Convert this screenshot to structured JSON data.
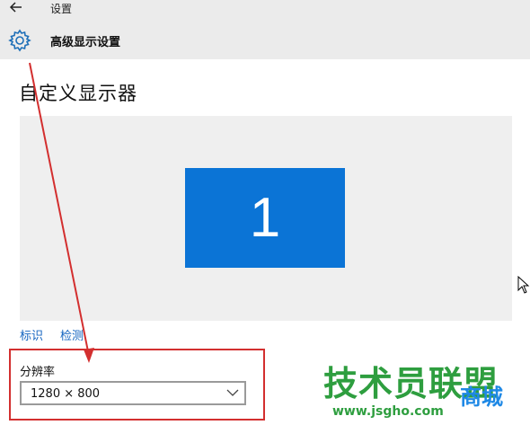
{
  "titlebar": {
    "title": "设置"
  },
  "header": {
    "page_name": "高级显示设置"
  },
  "main": {
    "title": "自定义显示器",
    "monitor_number": "1",
    "identify_link": "标识",
    "detect_link": "检测",
    "resolution_label": "分辨率",
    "resolution_value": "1280 × 800"
  },
  "watermark": {
    "logo_text": "技术员联盟",
    "accent_text": "商城",
    "url": "www.jsgho.com"
  },
  "colors": {
    "accent": "#0b74d6",
    "annotation": "#d32f2f",
    "link": "#1565c0",
    "watermark": "#2e9e3f"
  },
  "icons": [
    "back-arrow-icon",
    "gear-icon",
    "chevron-down-icon",
    "mouse-cursor-icon"
  ]
}
